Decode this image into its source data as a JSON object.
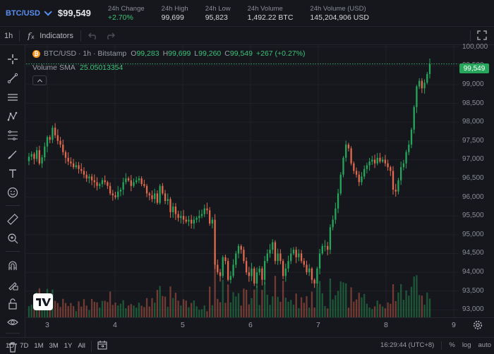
{
  "ticker": {
    "pair": "BTC/USD",
    "price": "$99,549",
    "stats": [
      {
        "label": "24h Change",
        "value": "+2.70%",
        "up": true
      },
      {
        "label": "24h High",
        "value": "99,699",
        "up": false
      },
      {
        "label": "24h Low",
        "value": "95,823",
        "up": false
      },
      {
        "label": "24h Volume",
        "value": "1,492.22 BTC",
        "up": false
      },
      {
        "label": "24h Volume (USD)",
        "value": "145,204,906 USD",
        "up": false
      }
    ]
  },
  "toolbar": {
    "interval": "1h",
    "indicators_label": "Indicators"
  },
  "legend": {
    "symbol": "BTC/USD · 1h · Bitstamp",
    "o_label": "O",
    "o": "99,283",
    "h_label": "H",
    "h": "99,699",
    "l_label": "L",
    "l": "99,260",
    "c_label": "C",
    "c": "99,549",
    "change": "+267 (+0.27%)",
    "volume_label": "Volume SMA",
    "volume_value": "25.05013354"
  },
  "price_tag": "99,549",
  "colors": {
    "up": "#26a65b",
    "down": "#e0694f",
    "accent": "#5a8ef0",
    "bg": "#16171c"
  },
  "icons": [
    "crosshair-icon",
    "trend-line-icon",
    "horizontal-lines-icon",
    "pattern-icon",
    "fib-icon",
    "brush-icon",
    "text-icon",
    "emoji-icon",
    "ruler-icon",
    "zoom-in-icon",
    "magnet-icon",
    "lock-drawing-icon",
    "lock-icon",
    "eye-icon",
    "trash-icon"
  ],
  "bottom": {
    "ranges": [
      "1D",
      "7D",
      "1M",
      "3M",
      "1Y",
      "All"
    ],
    "time": "16:29:44 (UTC+8)",
    "percent": "%",
    "log": "log",
    "auto": "auto"
  },
  "chart_data": {
    "type": "candlestick",
    "x_ticks": [
      "3",
      "4",
      "5",
      "6",
      "7",
      "8",
      "9"
    ],
    "y_ticks": [
      100000,
      99500,
      99000,
      98500,
      98000,
      97500,
      97000,
      96500,
      96000,
      95500,
      95000,
      94500,
      94000,
      93500,
      93000
    ],
    "y_tick_labels": [
      "100,000",
      "99,500",
      "99,000",
      "98,500",
      "98,000",
      "97,500",
      "97,000",
      "96,500",
      "96,000",
      "95,500",
      "95,000",
      "94,500",
      "94,000",
      "93,500",
      "93,000"
    ],
    "ylim": [
      92800,
      100050
    ],
    "last_close": 99549,
    "closes": [
      97080,
      97150,
      97020,
      97250,
      96900,
      97060,
      97350,
      97600,
      97530,
      97850,
      97650,
      97500,
      97400,
      97200,
      97050,
      96950,
      96900,
      96800,
      96850,
      96750,
      96700,
      96600,
      96500,
      96550,
      96450,
      96400,
      96300,
      96350,
      96450,
      96400,
      96300,
      96100,
      96050,
      96000,
      96150,
      96200,
      96400,
      96500,
      96450,
      96300,
      96400,
      96450,
      96500,
      96350,
      96300,
      96100,
      96050,
      95950,
      96100,
      95850,
      96300,
      96100,
      95900,
      95950,
      95600,
      95750,
      95550,
      95450,
      95500,
      95400,
      95350,
      95400,
      95300,
      95400,
      95450,
      95500,
      95550,
      95700,
      95650,
      95300,
      95400,
      94200,
      94000,
      93900,
      94400,
      94300,
      93800,
      93900,
      94200,
      94500,
      94700,
      94600,
      94300,
      94000,
      93900,
      94100,
      93700,
      94000,
      94100,
      93800,
      94300,
      94500,
      94600,
      94800,
      94300,
      94500,
      94300,
      93900,
      94100,
      94300,
      94500,
      94600,
      94400,
      94500,
      94300,
      94200,
      94000,
      94100,
      93800,
      93700,
      94100,
      94500,
      94700,
      94700,
      94600,
      95200,
      95400,
      95700,
      96100,
      96600,
      97050,
      97400,
      97300,
      96900,
      96700,
      96600,
      96400,
      96550,
      96750,
      96850,
      96950,
      97000,
      96900,
      97050,
      96950,
      97000,
      96900,
      96800,
      96700,
      96200,
      96150,
      96450,
      96800,
      96900,
      97200,
      97400,
      97800,
      98400,
      98950,
      99100,
      98900,
      99050,
      99280,
      99549
    ]
  }
}
